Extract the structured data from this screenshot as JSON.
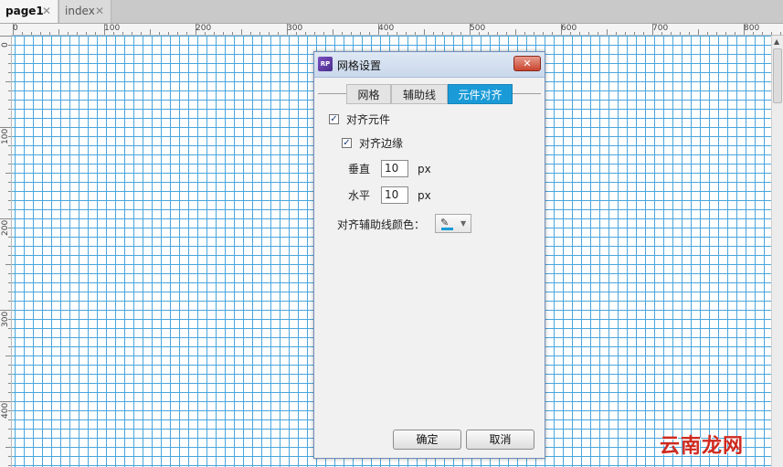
{
  "tabs": [
    {
      "label": "page1",
      "active": true
    },
    {
      "label": "index",
      "active": false
    }
  ],
  "tab_close_glyph": "✕",
  "ruler": {
    "top_labels": [
      "0",
      "100",
      "200",
      "300",
      "400",
      "500",
      "600",
      "700",
      "800"
    ],
    "left_labels": [
      "0",
      "100",
      "200",
      "300",
      "400"
    ]
  },
  "dialog": {
    "app_icon_text": "RP",
    "title": "网格设置",
    "close_glyph": "✕",
    "tabs": [
      "网格",
      "辅助线",
      "元件对齐"
    ],
    "active_tab": "元件对齐",
    "snap_to_widgets": {
      "label": "对齐元件",
      "checked": true
    },
    "snap_to_edges": {
      "label": "对齐边缘",
      "checked": true
    },
    "vertical": {
      "label": "垂直",
      "value": "10",
      "unit": "px"
    },
    "horizontal": {
      "label": "水平",
      "value": "10",
      "unit": "px"
    },
    "guide_color": {
      "label": "对齐辅助线颜色：",
      "color": "#1a9bd7"
    },
    "ok_label": "确定",
    "cancel_label": "取消"
  },
  "colors": {
    "grid_line": "#4aa6dd",
    "active_tab": "#1a9bd7"
  },
  "watermark": "云南龙网"
}
